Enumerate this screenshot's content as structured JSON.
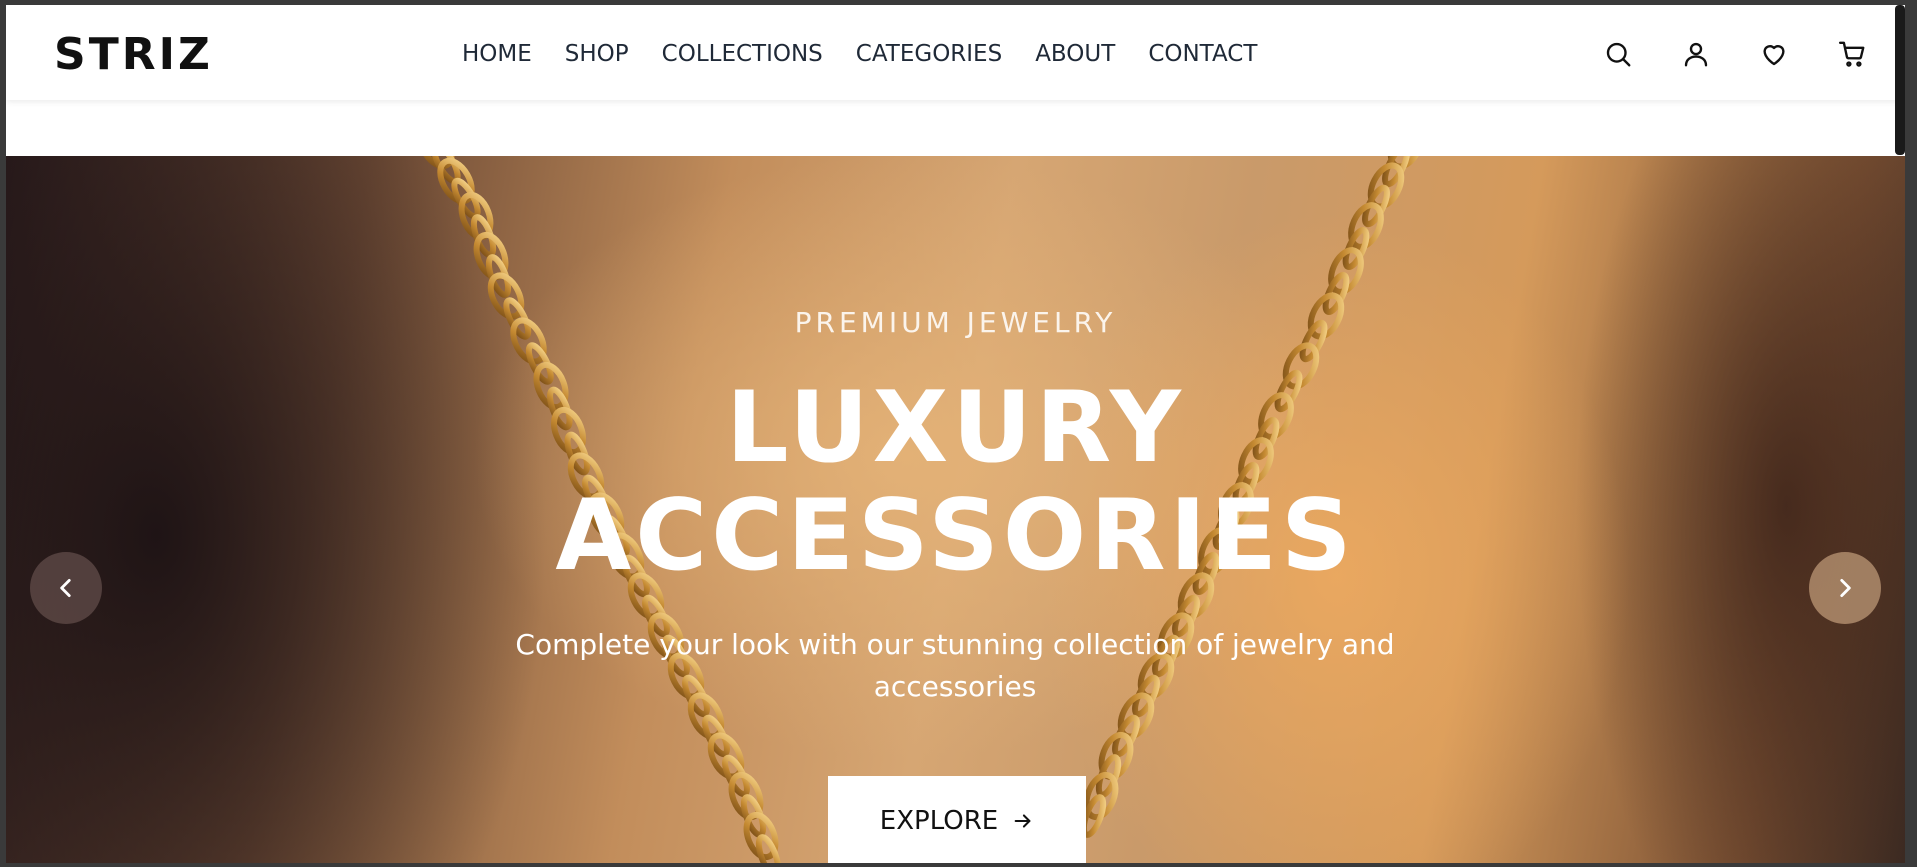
{
  "header": {
    "logo": "STRIZ",
    "nav": [
      "HOME",
      "SHOP",
      "COLLECTIONS",
      "CATEGORIES",
      "ABOUT",
      "CONTACT"
    ],
    "icons": [
      "search-icon",
      "user-icon",
      "heart-icon",
      "cart-icon"
    ]
  },
  "hero": {
    "eyebrow": "PREMIUM JEWELRY",
    "headline_line1": "LUXURY",
    "headline_line2": "ACCESSORIES",
    "subtitle": "Complete your look with our stunning collection of jewelry and accessories",
    "cta_label": "EXPLORE",
    "prev_icon": "chevron-left-icon",
    "next_icon": "chevron-right-icon"
  },
  "colors": {
    "text_dark": "#111111",
    "nav_text": "#1f2937",
    "hero_text": "#ffffff",
    "gold_chain": "#d9a650"
  }
}
